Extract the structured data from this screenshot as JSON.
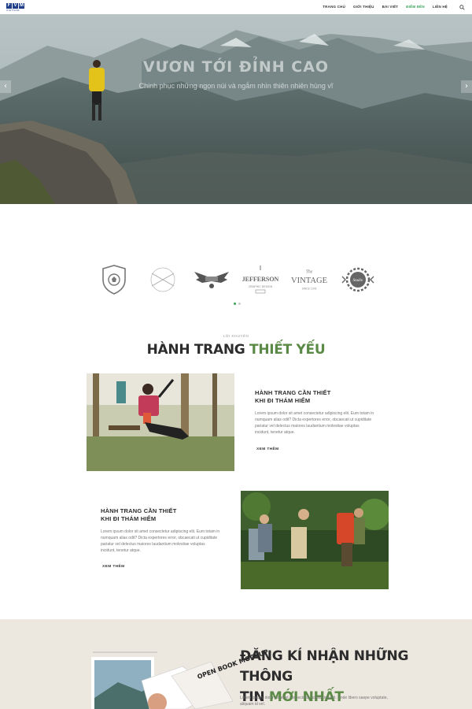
{
  "header": {
    "logo_letters": [
      "F",
      "V",
      "M"
    ],
    "logo_sub": "VIETNAM",
    "nav": [
      {
        "label": "TRANG CHỦ",
        "active": false
      },
      {
        "label": "GIỚI THIỆU",
        "active": false
      },
      {
        "label": "BÀI VIẾT",
        "active": false
      },
      {
        "label": "ĐIỂM ĐẾN",
        "active": true
      },
      {
        "label": "LIÊN HỆ",
        "active": false
      }
    ],
    "search_icon": "search-icon"
  },
  "hero": {
    "title": "VƯƠN TỚI ĐỈNH CAO",
    "subtitle": "Chinh phục những ngọn núi và ngắm nhìn thiên nhiên hùng vĩ",
    "prev_icon": "‹",
    "next_icon": "›"
  },
  "logos": {
    "items": [
      {
        "name": "shield-football-logo",
        "text": ""
      },
      {
        "name": "market-logo",
        "text": ""
      },
      {
        "name": "eagle-wings-logo",
        "text": ""
      },
      {
        "name": "jefferson-logo",
        "text": "JEFFERSON"
      },
      {
        "name": "vintage-logo",
        "text": "VINTAGE"
      },
      {
        "name": "gear-badge-logo",
        "text": ""
      }
    ],
    "active_dot": 0,
    "dot_count": 2
  },
  "section": {
    "eyebrow": "LỜI KHUYÊN",
    "title_main": "HÀNH TRANG",
    "title_accent": "THIẾT YẾU"
  },
  "cards": [
    {
      "title_line1": "HÀNH TRANG CẦN THIẾT",
      "title_line2": "KHI ĐI THÁM HIỂM",
      "text": "Lorem ipsum dolor sit amet consectetur adipiscing elit. Eum totam in numquam alias odit? Dicta expertores error, obcaecati ut cupiditate pariatur vel delectus maiores laudantium molestiae voluptas incidunt, tenetur atque.",
      "link": "XEM THÊM"
    },
    {
      "title_line1": "HÀNH TRANG CẦN THIẾT",
      "title_line2": "KHI ĐI THÁM HIỂM",
      "text": "Lorem ipsum dolor sit amet consectetur adipiscing elit. Eum totam in numquam alias odit? Dicta expertores error, obcaecati ut cupiditate pariatur vel delectus maiores laudantium molestiae voluptas incidunt, tenetur atque.",
      "link": "XEM THÊM"
    }
  ],
  "newsletter": {
    "title_line1": "ĐĂNG KÍ NHẬN NHỮNG THÔNG",
    "title_line2_main": "TIN",
    "title_line2_accent": "MỚI NHẤT",
    "text": "Lorem ipsum, dolor sit amet consectetur adipisicing elit. Unde libero saepe voluptate, aliquam id vel.",
    "mockup_text": "OPEN BOOK MOCKUP"
  },
  "colors": {
    "accent": "#3aa35b",
    "title_green": "#5a8a45",
    "brand_blue": "#1f3f8a",
    "newsletter_bg": "#ece7df"
  }
}
